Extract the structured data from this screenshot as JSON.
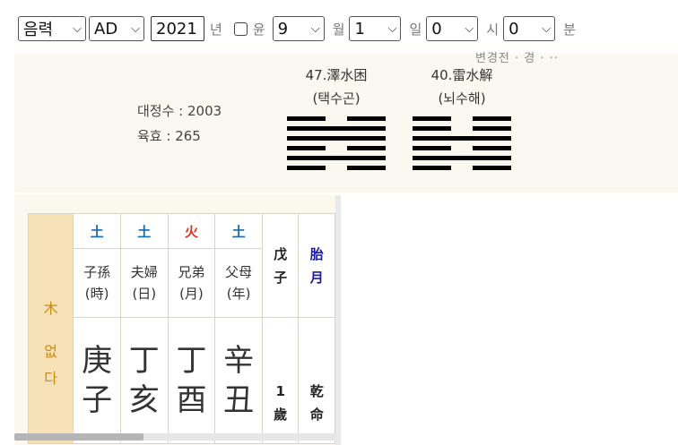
{
  "form": {
    "calendar_value": "음력",
    "era_value": "AD",
    "year_value": "2021",
    "year_unit": "년",
    "leap_label": "윤",
    "month_value": "9",
    "month_unit": "월",
    "day_value": "1",
    "day_unit": "일",
    "hour_value": "0",
    "hour_unit": "시",
    "minute_value": "0",
    "minute_unit": "분"
  },
  "gua": {
    "cut_text": "변경전 · 경 · ··",
    "stat1": "대정수 : 2003",
    "stat2": "육효 : 265",
    "gua1_name": "47.澤水困",
    "gua1_reading": "(택수곤)",
    "gua2_name": "40.雷水解",
    "gua2_reading": "(뇌수해)",
    "gua1_lines": [
      0,
      1,
      1,
      0,
      1,
      0
    ],
    "gua2_lines": [
      0,
      0,
      1,
      0,
      1,
      0
    ]
  },
  "table": {
    "side_top": "木",
    "side_bottom": [
      "없",
      "다"
    ],
    "columns": [
      {
        "element": "土",
        "rel": "子孫",
        "pillar": "(時)",
        "gan": "庚",
        "ji": "子"
      },
      {
        "element": "土",
        "rel": "夫婦",
        "pillar": "(日)",
        "gan": "丁",
        "ji": "亥"
      },
      {
        "element": "火",
        "rel": "兄弟",
        "pillar": "(月)",
        "gan": "丁",
        "ji": "酉"
      },
      {
        "element": "土",
        "rel": "父母",
        "pillar": "(年)",
        "gan": "辛",
        "ji": "丑"
      }
    ],
    "daeun_top1": "戊",
    "daeun_top2": "子",
    "daeun_age1": "1",
    "daeun_age2": "歲",
    "tae_top1": "胎",
    "tae_top2": "月",
    "tae_bottom1": "乾",
    "tae_bottom2": "命"
  }
}
